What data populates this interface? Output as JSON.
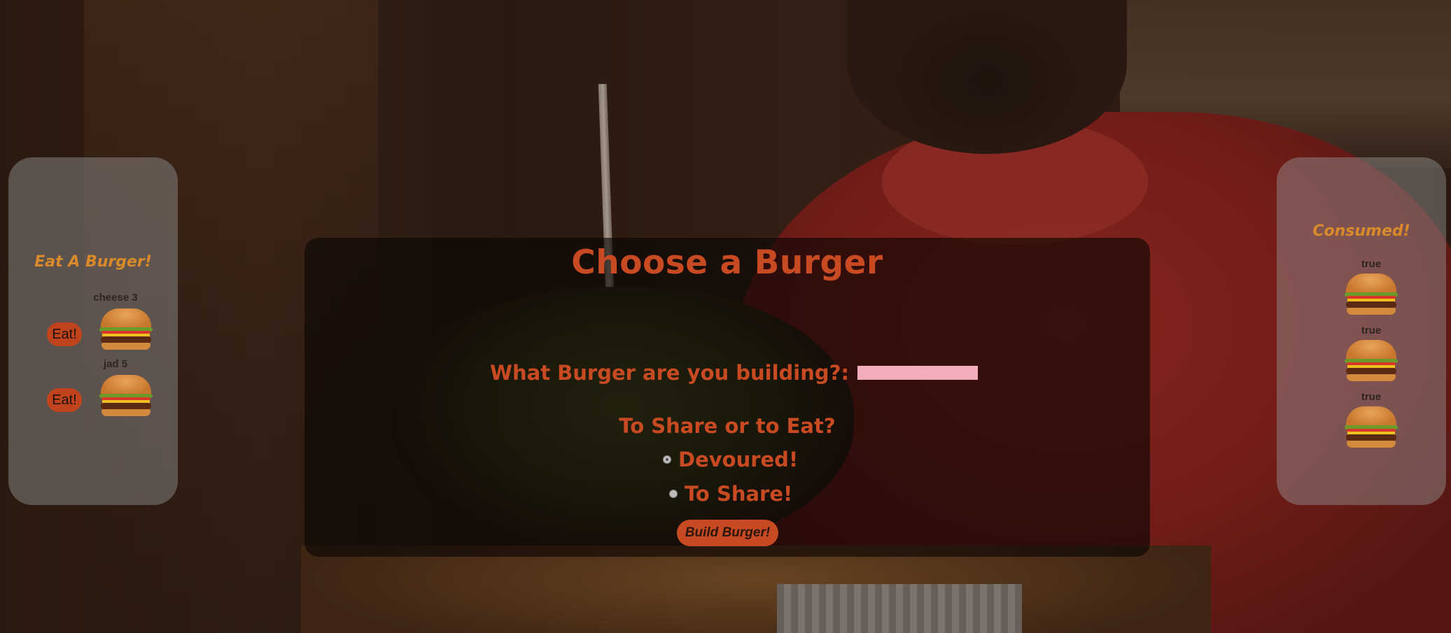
{
  "left_panel": {
    "title": "Eat A Burger!",
    "items": [
      {
        "name": "cheese 3",
        "button_label": "Eat!"
      },
      {
        "name": "jad 5",
        "button_label": "Eat!"
      }
    ]
  },
  "main": {
    "title": "Choose a Burger",
    "name_label": "What Burger are you building?:",
    "name_value": "",
    "share_heading": "To Share or to Eat?",
    "options": [
      {
        "label": "Devoured!",
        "checked": true
      },
      {
        "label": "To Share!",
        "checked": false
      }
    ],
    "submit_label": "Build Burger!"
  },
  "right_panel": {
    "title": "Consumed!",
    "items": [
      {
        "status": "true"
      },
      {
        "status": "true"
      },
      {
        "status": "true"
      }
    ]
  },
  "colors": {
    "accent": "#c84a22",
    "panel_title": "#d98a2a",
    "input_bg": "#f2aebc"
  },
  "icons": {
    "burger": "burger-icon",
    "radio": "radio-icon"
  }
}
